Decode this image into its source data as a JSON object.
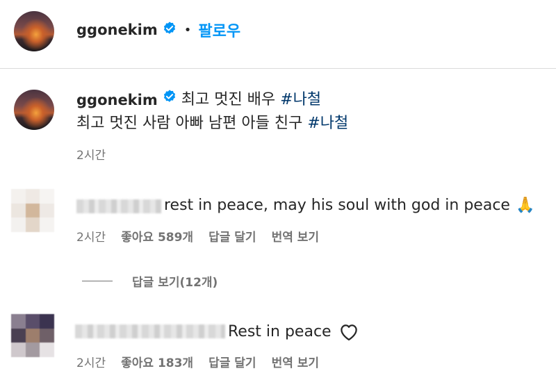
{
  "header": {
    "username": "ggonekim",
    "separator": "•",
    "follow_label": "팔로우"
  },
  "post": {
    "username": "ggonekim",
    "caption_line1": "최고 멋진 배우 ",
    "hashtag1": "#나철",
    "caption_line2": "최고 멋진 사람 아빠 남편 아들 친구 ",
    "hashtag2": "#나철",
    "time": "2시간"
  },
  "comments": [
    {
      "text": "rest in peace, may his soul with god in peace",
      "emoji": "🙏",
      "time": "2시간",
      "likes": "좋아요 589개",
      "reply_label": "답글 달기",
      "translate_label": "번역 보기",
      "view_replies_label": "답글 보기(12개)"
    },
    {
      "text": "Rest in peace",
      "time": "2시간",
      "likes": "좋아요 183개",
      "reply_label": "답글 달기",
      "translate_label": "번역 보기"
    }
  ],
  "colors": {
    "accent": "#0095f6",
    "hashtag": "#00376b",
    "verified": "#0095f6",
    "meta": "#737373"
  }
}
